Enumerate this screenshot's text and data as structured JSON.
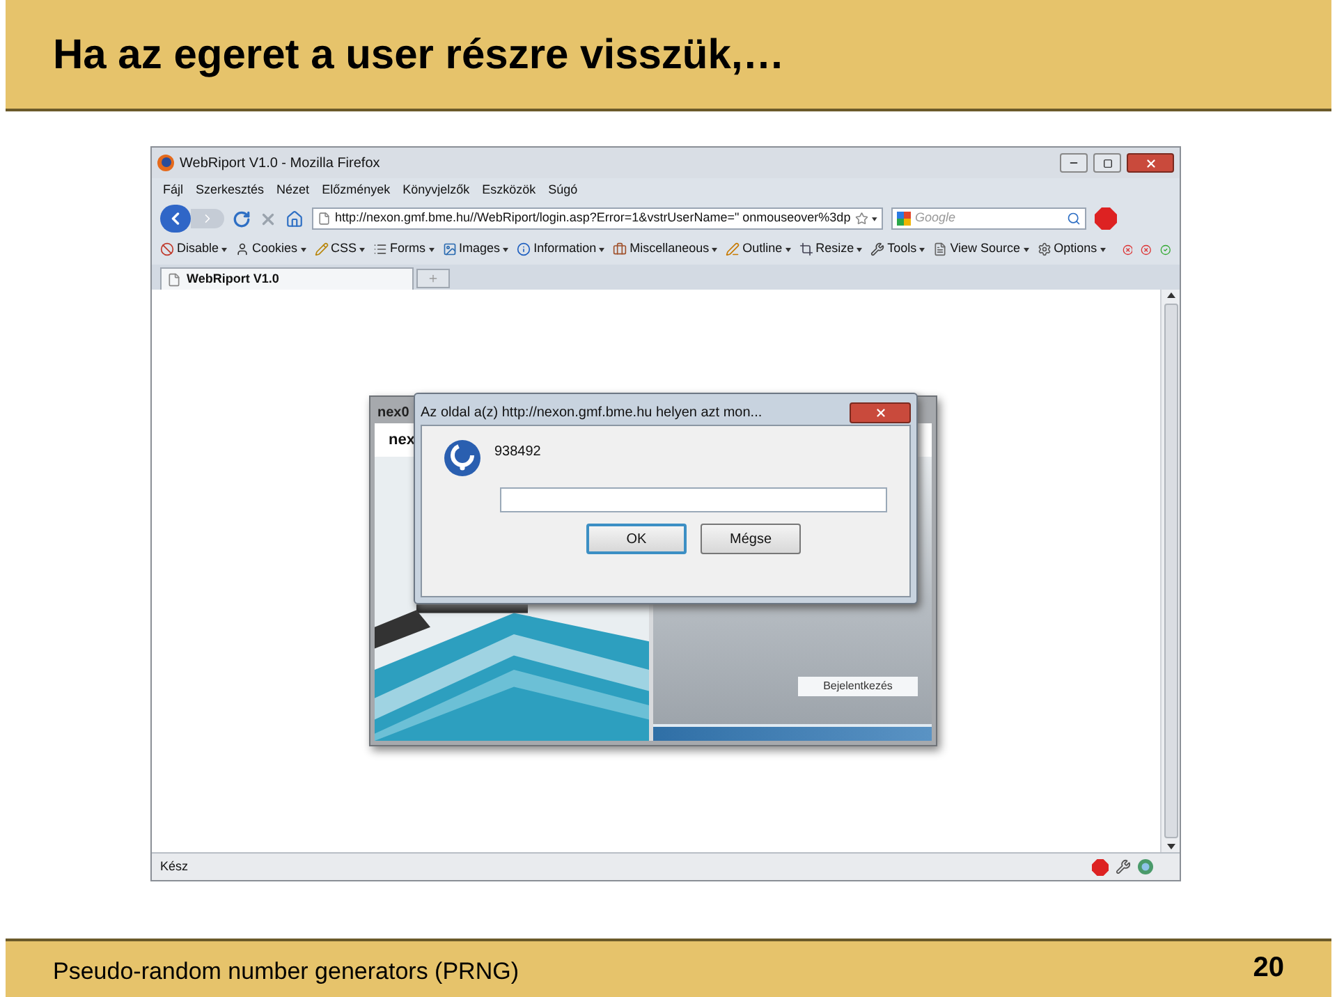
{
  "slide": {
    "title": "Ha az egeret a user részre visszük,…",
    "footer": "Pseudo-random number generators (PRNG)",
    "page_number": "20"
  },
  "browser": {
    "title": "WebRiport V1.0 - Mozilla Firefox",
    "menu": [
      "Fájl",
      "Szerkesztés",
      "Nézet",
      "Előzmények",
      "Könyvjelzők",
      "Eszközök",
      "Súgó"
    ],
    "url": "http://nexon.gmf.bme.hu//WebRiport/login.asp?Error=1&vstrUserName=\" onmouseover%3dp",
    "search_placeholder": "Google",
    "toolbar": [
      "Disable",
      "Cookies",
      "CSS",
      "Forms",
      "Images",
      "Information",
      "Miscellaneous",
      "Outline",
      "Resize",
      "Tools",
      "View Source",
      "Options"
    ],
    "tabs": [
      {
        "label": "WebRiport V1.0",
        "selected": true
      }
    ],
    "status": "Kész"
  },
  "app_window": {
    "title": "nex0",
    "heading": "nex",
    "login_button": "Bejelentkezés"
  },
  "dialog": {
    "title": "Az oldal a(z) http://nexon.gmf.bme.hu helyen azt mon...",
    "message": "938492",
    "buttons": [
      {
        "label": "OK",
        "selected": true
      },
      {
        "label": "Mégse",
        "selected": false
      }
    ]
  }
}
